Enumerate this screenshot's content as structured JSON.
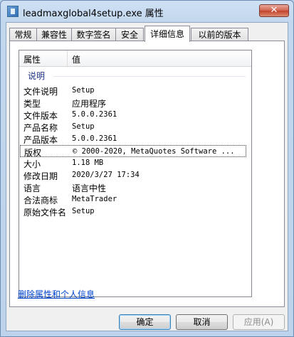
{
  "window": {
    "title": "leadmaxglobal4setup.exe 属性",
    "close_label": "✕"
  },
  "tabs": [
    {
      "label": "常规",
      "active": false
    },
    {
      "label": "兼容性",
      "active": false
    },
    {
      "label": "数字签名",
      "active": false
    },
    {
      "label": "安全",
      "active": false
    },
    {
      "label": "详细信息",
      "active": true
    },
    {
      "label": "以前的版本",
      "active": false
    }
  ],
  "listview": {
    "header": {
      "property": "属性",
      "value": "值"
    },
    "group": "说明",
    "rows": [
      {
        "property": "文件说明",
        "value": "Setup"
      },
      {
        "property": "类型",
        "value": "应用程序"
      },
      {
        "property": "文件版本",
        "value": "5.0.0.2361"
      },
      {
        "property": "产品名称",
        "value": "Setup"
      },
      {
        "property": "产品版本",
        "value": "5.0.0.2361"
      },
      {
        "property": "版权",
        "value": "© 2000-2020, MetaQuotes Software ..."
      },
      {
        "property": "大小",
        "value": "1.18 MB"
      },
      {
        "property": "修改日期",
        "value": "2020/3/27 17:34"
      },
      {
        "property": "语言",
        "value": "语言中性"
      },
      {
        "property": "合法商标",
        "value": "MetaTrader"
      },
      {
        "property": "原始文件名",
        "value": "Setup"
      }
    ]
  },
  "remove_link": "删除属性和个人信息",
  "buttons": {
    "ok": "确定",
    "cancel": "取消",
    "apply": "应用(A)"
  }
}
